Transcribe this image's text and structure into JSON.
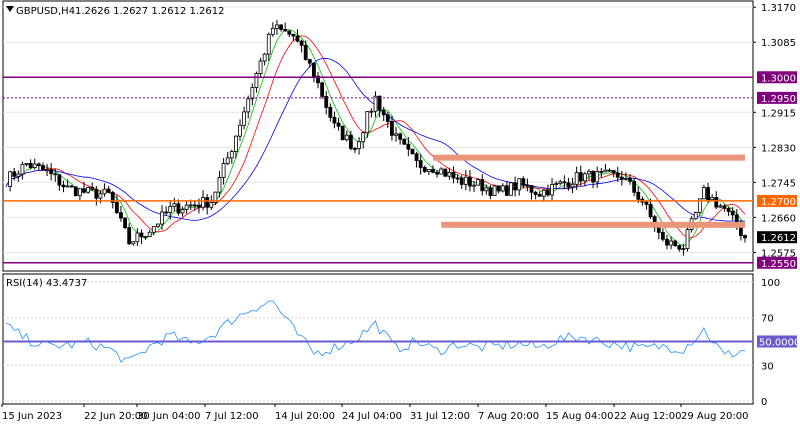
{
  "chart_data": [
    {
      "type": "candlestick",
      "symbol": "GBPUSD,H4",
      "ohlc": "1.2626 1.2627 1.2612 1.2612",
      "y_range": [
        1.253,
        1.3185
      ],
      "price_ticks": [
        "1.3170",
        "1.3085",
        "1.2915",
        "1.2830",
        "1.2745",
        "1.2660",
        "1.2575"
      ],
      "price_tags": [
        {
          "label": "1.3000",
          "value": 1.3,
          "color": "#800080",
          "line": "solid"
        },
        {
          "label": "1.2950",
          "value": 1.295,
          "color": "#800080",
          "line": "dotted"
        },
        {
          "label": "1.2700",
          "value": 1.27,
          "color": "#ff6600",
          "line": "solid"
        },
        {
          "label": "1.2612",
          "value": 1.2612,
          "color": "#000000",
          "line": "none"
        },
        {
          "label": "1.2550",
          "value": 1.255,
          "color": "#800080",
          "line": "solid"
        }
      ],
      "zones": [
        {
          "from_index": 104,
          "to_index": 180,
          "value": 1.2805,
          "color": "#e9967a"
        },
        {
          "from_index": 106,
          "to_index": 180,
          "value": 1.2642,
          "color": "#e9967a"
        }
      ],
      "moving_average_colors": [
        "#00c000",
        "#ff0000",
        "#0000ff"
      ],
      "close_path": [
        [
          0,
          1.275
        ],
        [
          5,
          1.279
        ],
        [
          10,
          1.277
        ],
        [
          15,
          1.273
        ],
        [
          20,
          1.272
        ],
        [
          25,
          1.2715
        ],
        [
          30,
          1.26
        ],
        [
          35,
          1.263
        ],
        [
          40,
          1.268
        ],
        [
          45,
          1.269
        ],
        [
          50,
          1.27
        ],
        [
          55,
          1.283
        ],
        [
          60,
          1.298
        ],
        [
          65,
          1.312
        ],
        [
          70,
          1.31
        ],
        [
          75,
          1.301
        ],
        [
          80,
          1.288
        ],
        [
          85,
          1.283
        ],
        [
          90,
          1.295
        ],
        [
          95,
          1.285
        ],
        [
          100,
          1.279
        ],
        [
          105,
          1.278
        ],
        [
          110,
          1.275
        ],
        [
          115,
          1.274
        ],
        [
          120,
          1.272
        ],
        [
          125,
          1.274
        ],
        [
          130,
          1.272
        ],
        [
          135,
          1.274
        ],
        [
          140,
          1.276
        ],
        [
          145,
          1.276
        ],
        [
          150,
          1.276
        ],
        [
          155,
          1.27
        ],
        [
          160,
          1.26
        ],
        [
          165,
          1.259
        ],
        [
          170,
          1.272
        ],
        [
          175,
          1.268
        ],
        [
          180,
          1.2612
        ]
      ]
    },
    {
      "type": "line",
      "title": "RSI(14) 43.4737",
      "y_range": [
        0,
        100
      ],
      "ticks": [
        "100",
        "70",
        "30",
        "0"
      ],
      "level": {
        "label": "50.0000",
        "value": 50,
        "color": "#6a5acd"
      },
      "line_color": "#1e90ff",
      "path": [
        [
          0,
          63
        ],
        [
          5,
          52
        ],
        [
          10,
          46
        ],
        [
          15,
          47
        ],
        [
          20,
          49
        ],
        [
          25,
          44
        ],
        [
          30,
          32
        ],
        [
          35,
          46
        ],
        [
          40,
          55
        ],
        [
          45,
          48
        ],
        [
          50,
          55
        ],
        [
          55,
          68
        ],
        [
          60,
          78
        ],
        [
          65,
          84
        ],
        [
          70,
          60
        ],
        [
          75,
          40
        ],
        [
          80,
          45
        ],
        [
          85,
          52
        ],
        [
          90,
          65
        ],
        [
          95,
          44
        ],
        [
          100,
          50
        ],
        [
          105,
          42
        ],
        [
          110,
          48
        ],
        [
          115,
          45
        ],
        [
          120,
          46
        ],
        [
          125,
          48
        ],
        [
          130,
          45
        ],
        [
          135,
          52
        ],
        [
          140,
          54
        ],
        [
          145,
          50
        ],
        [
          150,
          47
        ],
        [
          155,
          44
        ],
        [
          160,
          46
        ],
        [
          165,
          44
        ],
        [
          170,
          60
        ],
        [
          175,
          38
        ],
        [
          180,
          43
        ]
      ]
    }
  ],
  "time_axis": [
    "15 Jun 2023",
    "22 Jun 20:00",
    "30 Jun 04:00",
    "7 Jul 12:00",
    "14 Jul 20:00",
    "24 Jul 04:00",
    "31 Jul 12:00",
    "7 Aug 20:00",
    "15 Aug 04:00",
    "22 Aug 12:00",
    "29 Aug 20:00"
  ]
}
